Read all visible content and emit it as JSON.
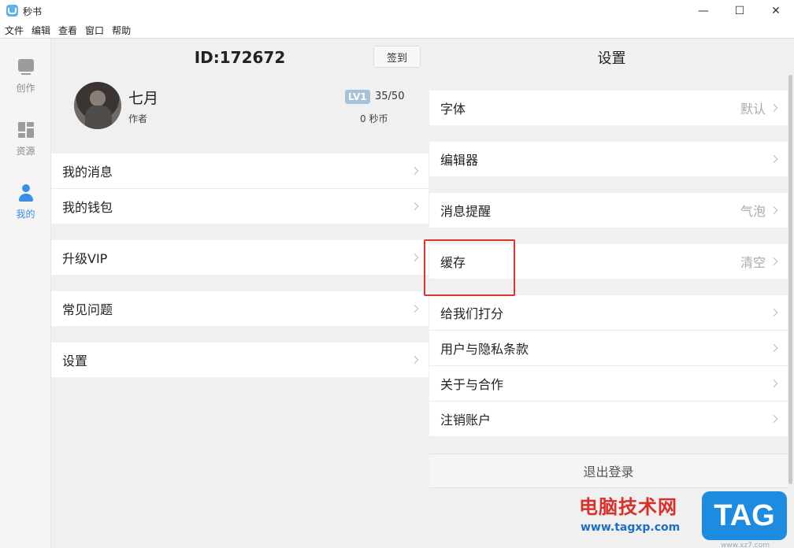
{
  "window": {
    "title": "秒书",
    "controls": {
      "minimize": "—",
      "maximize": "☐",
      "close": "✕"
    }
  },
  "menu": [
    "文件",
    "编辑",
    "查看",
    "窗口",
    "帮助"
  ],
  "sidebar": {
    "items": [
      {
        "label": "创作",
        "icon": "create-icon",
        "active": false
      },
      {
        "label": "资源",
        "icon": "resources-icon",
        "active": false
      },
      {
        "label": "我的",
        "icon": "profile-icon",
        "active": true
      }
    ],
    "active_color": "#3b8ee6"
  },
  "account": {
    "id_text": "ID:172672",
    "signin_label": "签到",
    "name": "七月",
    "role": "作者",
    "level_badge": "LV1",
    "level_exp": "35/50",
    "coins": "0 秒币"
  },
  "left_menu": {
    "items": [
      "我的消息",
      "我的钱包",
      "升级VIP",
      "常见问题",
      "设置"
    ]
  },
  "settings": {
    "title": "设置",
    "items": [
      {
        "label": "字体",
        "value": "默认"
      },
      {
        "label": "编辑器",
        "value": ""
      },
      {
        "label": "消息提醒",
        "value": "气泡"
      },
      {
        "label": "缓存",
        "value": "清空"
      },
      {
        "label": "给我们打分",
        "value": ""
      },
      {
        "label": "用户与隐私条款",
        "value": ""
      },
      {
        "label": "关于与合作",
        "value": ""
      },
      {
        "label": "注销账户",
        "value": ""
      }
    ],
    "logout_label": "退出登录"
  },
  "watermark": {
    "cn_text": "电脑技术网",
    "url": "www.tagxp.com",
    "tag": "TAG",
    "sub": "www.xz7.com"
  },
  "colors": {
    "highlight_box": "#e0342c",
    "watermark_blue": "#1c8be0",
    "watermark_red": "#d9302b"
  }
}
